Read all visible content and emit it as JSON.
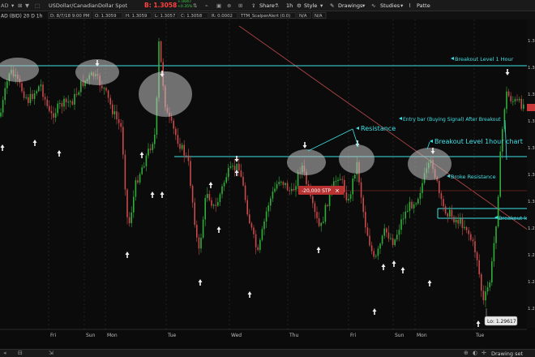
{
  "toolbar": {
    "symbol_partial": "AD",
    "study_label": "AD (BID) 20 D 1h",
    "instrument_name": "USDollar/CanadianDollar Spot",
    "bid_label": "B: 1.3058",
    "change_label": "+.0047",
    "change_pct_label": "+0.35%",
    "date_field": "D: 8/7/18 9:00 PM",
    "open_field": "O: 1.3059",
    "high_field": "H: 1.3059",
    "low_field": "L: 1.3057",
    "close_field": "C: 1.3058",
    "range_field": "R: 0.0002",
    "indicator_field": "TTM_ScalperAlert (0.0)",
    "na1": "N/A",
    "na2": "N/A",
    "share_label": "Share",
    "timeframe_label": "1h",
    "style_label": "Style",
    "drawings_label": "Drawings",
    "studies_label": "Studies",
    "patterns_partial": "Patte"
  },
  "x_axis_labels": [
    "Fri",
    "Sun",
    "Mon",
    "Tue",
    "Wed",
    "Thu",
    "Fri",
    "Sun",
    "Mon",
    "Tue"
  ],
  "y_axis_partials": [
    "1.3",
    "1.3",
    "1.3",
    "1.3",
    "1.3",
    "1.3",
    "1.3",
    "1.2",
    "1.2",
    "1.2",
    "1.2"
  ],
  "annotations": {
    "breakout_1h": "Breakout Level 1 Hour",
    "entry_bar": "Entry bar (Buying Signal) After Breakout",
    "resistance": "Resistance",
    "breakout_1hour_chart": "Breakout Level 1hour chart",
    "broke_resistance": "Broke Resistance",
    "breakout_lev": "Breakout lev",
    "stop_order": "-20,000 STP",
    "stop_close": "✕",
    "lo_label": "Lo: 1.29617"
  },
  "bottom": {
    "drawing_set": "Drawing set"
  },
  "colors": {
    "background": "#0b0b0b",
    "up_candle": "#2fae3a",
    "down_candle": "#c84a4a",
    "cyan": "#3fe0e6",
    "stop_red": "#b83232",
    "trend_line": "#a04040"
  }
}
